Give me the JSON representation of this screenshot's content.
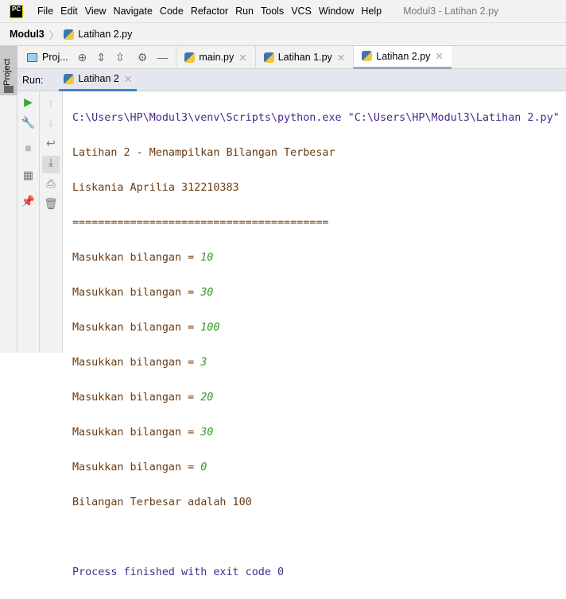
{
  "menubar": {
    "logo": "PC",
    "items": [
      "File",
      "Edit",
      "View",
      "Navigate",
      "Code",
      "Refactor",
      "Run",
      "Tools",
      "VCS",
      "Window",
      "Help"
    ],
    "window_title": "Modul3 - Latihan 2.py"
  },
  "breadcrumb": {
    "project": "Modul3",
    "file": "Latihan 2.py"
  },
  "sidebar": {
    "project_tab": "Project"
  },
  "toolbar": {
    "project_label": "Proj..."
  },
  "editor_tabs": [
    {
      "label": "main.py"
    },
    {
      "label": "Latihan 1.py"
    },
    {
      "label": "Latihan 2.py",
      "active": true
    }
  ],
  "run": {
    "label": "Run:",
    "tab": "Latihan 2"
  },
  "console": {
    "command": "C:\\Users\\HP\\Modul3\\venv\\Scripts\\python.exe \"C:\\Users\\HP\\Modul3\\Latihan 2.py\"",
    "header": [
      "Latihan 2 - Menampilkan Bilangan Terbesar",
      "Liskania Aprilia 312210383",
      "========================================"
    ],
    "prompt": "Masukkan bilangan = ",
    "inputs": [
      "10",
      "30",
      "100",
      "3",
      "20",
      "30",
      "0"
    ],
    "result": "Bilangan Terbesar adalah 100",
    "finish": "Process finished with exit code 0"
  }
}
